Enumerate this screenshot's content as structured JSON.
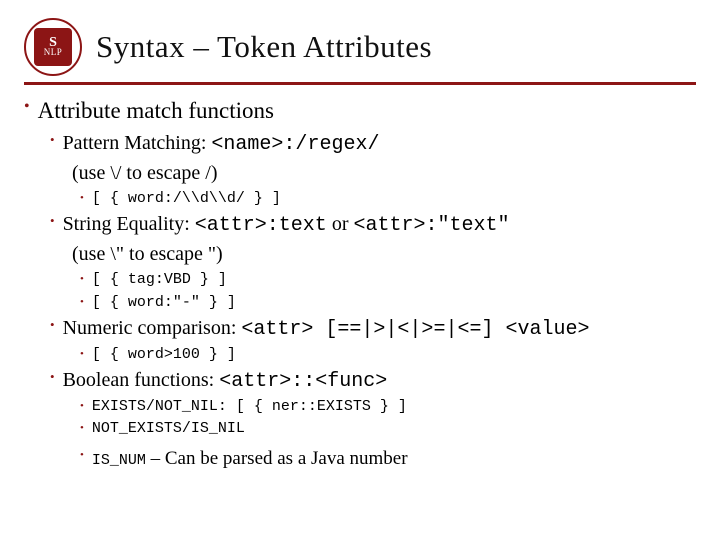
{
  "logo": {
    "top": "S",
    "bottom": "NLP"
  },
  "title": "Syntax – Token Attributes",
  "h1": "Attribute match functions",
  "pattern": {
    "label": "Pattern Matching: ",
    "code": "<name>:/regex/",
    "note": "(use \\/ to escape /)",
    "ex1": "[ { word:/\\\\d\\\\d/ } ]"
  },
  "string": {
    "label": "String Equality: ",
    "code1": "<attr>:text",
    "mid": " or ",
    "code2": "<attr>:\"text\"",
    "note": "(use \\\" to escape \")",
    "ex1": "[ { tag:VBD } ]",
    "ex2": "[ { word:\"-\" } ]"
  },
  "numeric": {
    "label": "Numeric comparison: ",
    "code": "<attr> [==|>|<|>=|<=] <value>",
    "ex1": "[ { word>100 } ]"
  },
  "boolean": {
    "label": "Boolean functions: ",
    "code": "<attr>::<func>",
    "ex1": "EXISTS/NOT_NIL: [ { ner::EXISTS } ]",
    "ex2": "NOT_EXISTS/IS_NIL",
    "ex3code": "IS_NUM",
    "ex3text": " – Can be parsed as a Java number"
  }
}
